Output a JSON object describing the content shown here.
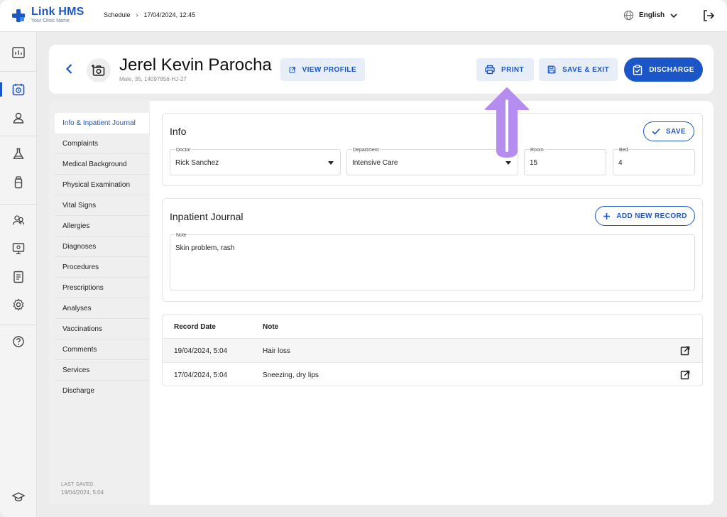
{
  "app": {
    "name": "Link HMS",
    "clinic_name": "Your Clinic Name",
    "brand_color": "#1a56c8"
  },
  "breadcrumb": {
    "section": "Schedule",
    "separator": "›",
    "current": "17/04/2024, 12:45"
  },
  "language": {
    "selected": "English",
    "icon": "globe-icon"
  },
  "sidebar": {
    "items": [
      {
        "name": "dashboard",
        "icon": "dashboard-icon"
      },
      {
        "name": "schedule",
        "icon": "calendar-icon",
        "active": true
      },
      {
        "name": "patients",
        "icon": "person-icon"
      },
      {
        "name": "lab",
        "icon": "flask-icon"
      },
      {
        "name": "pharmacy",
        "icon": "bottle-icon"
      },
      {
        "name": "staff",
        "icon": "users-icon"
      },
      {
        "name": "monitor",
        "icon": "monitor-icon"
      },
      {
        "name": "reports",
        "icon": "document-icon"
      },
      {
        "name": "settings",
        "icon": "gear-icon"
      },
      {
        "name": "help",
        "icon": "help-icon"
      },
      {
        "name": "education",
        "icon": "graduation-cap-icon"
      }
    ]
  },
  "patient": {
    "name": "Jerel Kevin Parocha",
    "meta": "Male, 35, 14097856-HJ-27"
  },
  "header_actions": {
    "view_profile": "VIEW PROFILE",
    "print": "PRINT",
    "save_exit": "SAVE & EXIT",
    "discharge": "DISCHARGE"
  },
  "left_nav": {
    "items": [
      "Info & Inpatient Journal",
      "Complaints",
      "Medical Background",
      "Physical Examination",
      "Vital Signs",
      "Allergies",
      "Diagnoses",
      "Procedures",
      "Prescriptions",
      "Analyses",
      "Vaccinations",
      "Comments",
      "Services",
      "Discharge"
    ],
    "active_index": 0,
    "last_saved_label": "LAST SAVED",
    "last_saved_value": "19/04/2024, 5:04"
  },
  "info": {
    "title": "Info",
    "save_label": "SAVE",
    "fields": {
      "doctor": {
        "label": "Doctor",
        "value": "Rick Sanchez"
      },
      "department": {
        "label": "Department",
        "value": "Intensive Care"
      },
      "room": {
        "label": "Room",
        "value": "15"
      },
      "bed": {
        "label": "Bed",
        "value": "4"
      }
    }
  },
  "journal": {
    "title": "Inpatient Journal",
    "add_label": "ADD NEW RECORD",
    "note_label": "Note",
    "note_value": "Skin problem, rash"
  },
  "records": {
    "columns": [
      "Record Date",
      "Note"
    ],
    "rows": [
      {
        "date": "19/04/2024, 5:04",
        "note": "Hair loss"
      },
      {
        "date": "17/04/2024, 5:04",
        "note": "Sneezing, dry lips"
      }
    ]
  },
  "annotation": {
    "color": "#b58cf0",
    "target": "PRINT"
  }
}
